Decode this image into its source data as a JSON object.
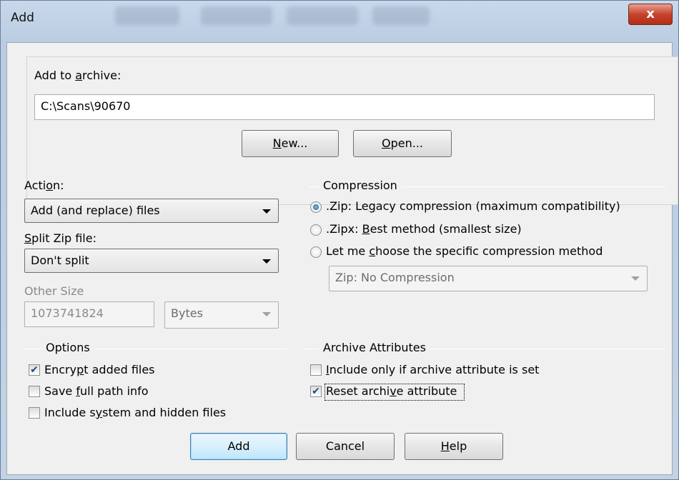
{
  "window": {
    "title": "Add",
    "close_label": "x"
  },
  "archive": {
    "label_pre": "Add to ",
    "label_u": "a",
    "label_post": "rchive:",
    "path": "C:\\Scans\\90670",
    "new_u": "N",
    "new_rest": "ew...",
    "open_u": "O",
    "open_rest": "pen..."
  },
  "action": {
    "label_pre": "Acti",
    "label_u": "o",
    "label_post": "n:",
    "value": "Add (and replace) files"
  },
  "split": {
    "label_u": "S",
    "label_post": "plit Zip file:",
    "value": "Don't split"
  },
  "other_size": {
    "label": "Other Size",
    "value": "1073741824",
    "unit": "Bytes"
  },
  "compression": {
    "heading": "Compression",
    "zip_pre": ".Zip: Le",
    "zip_u": "g",
    "zip_post": "acy compression (maximum compatibility)",
    "zipx_pre": ".Zipx: ",
    "zipx_u": "B",
    "zipx_post": "est method (smallest size)",
    "choose_pre": "Let me ",
    "choose_u": "c",
    "choose_post": "hoose the specific compression method",
    "method_value": "Zip: No Compression",
    "selected": "zip"
  },
  "options": {
    "heading": "Options",
    "encrypt_pre": "Encry",
    "encrypt_u": "p",
    "encrypt_post": "t added files",
    "encrypt_checked": true,
    "fullpath_pre": "Save ",
    "fullpath_u": "f",
    "fullpath_post": "ull path info",
    "fullpath_checked": false,
    "system_pre": "Include s",
    "system_u": "y",
    "system_post": "stem and hidden files",
    "system_checked": false
  },
  "attributes": {
    "heading": "Archive Attributes",
    "include_pre": "",
    "include_u": "I",
    "include_post": "nclude only if archive attribute is set",
    "include_checked": false,
    "reset_pre": "Reset archi",
    "reset_u": "v",
    "reset_post": "e attribute",
    "reset_checked": true
  },
  "buttons": {
    "add": "Add",
    "cancel": "Cancel",
    "help_u": "H",
    "help_rest": "elp"
  },
  "colors": {
    "default_button_border": "#3c7fb1",
    "close_button": "#c7432c"
  }
}
